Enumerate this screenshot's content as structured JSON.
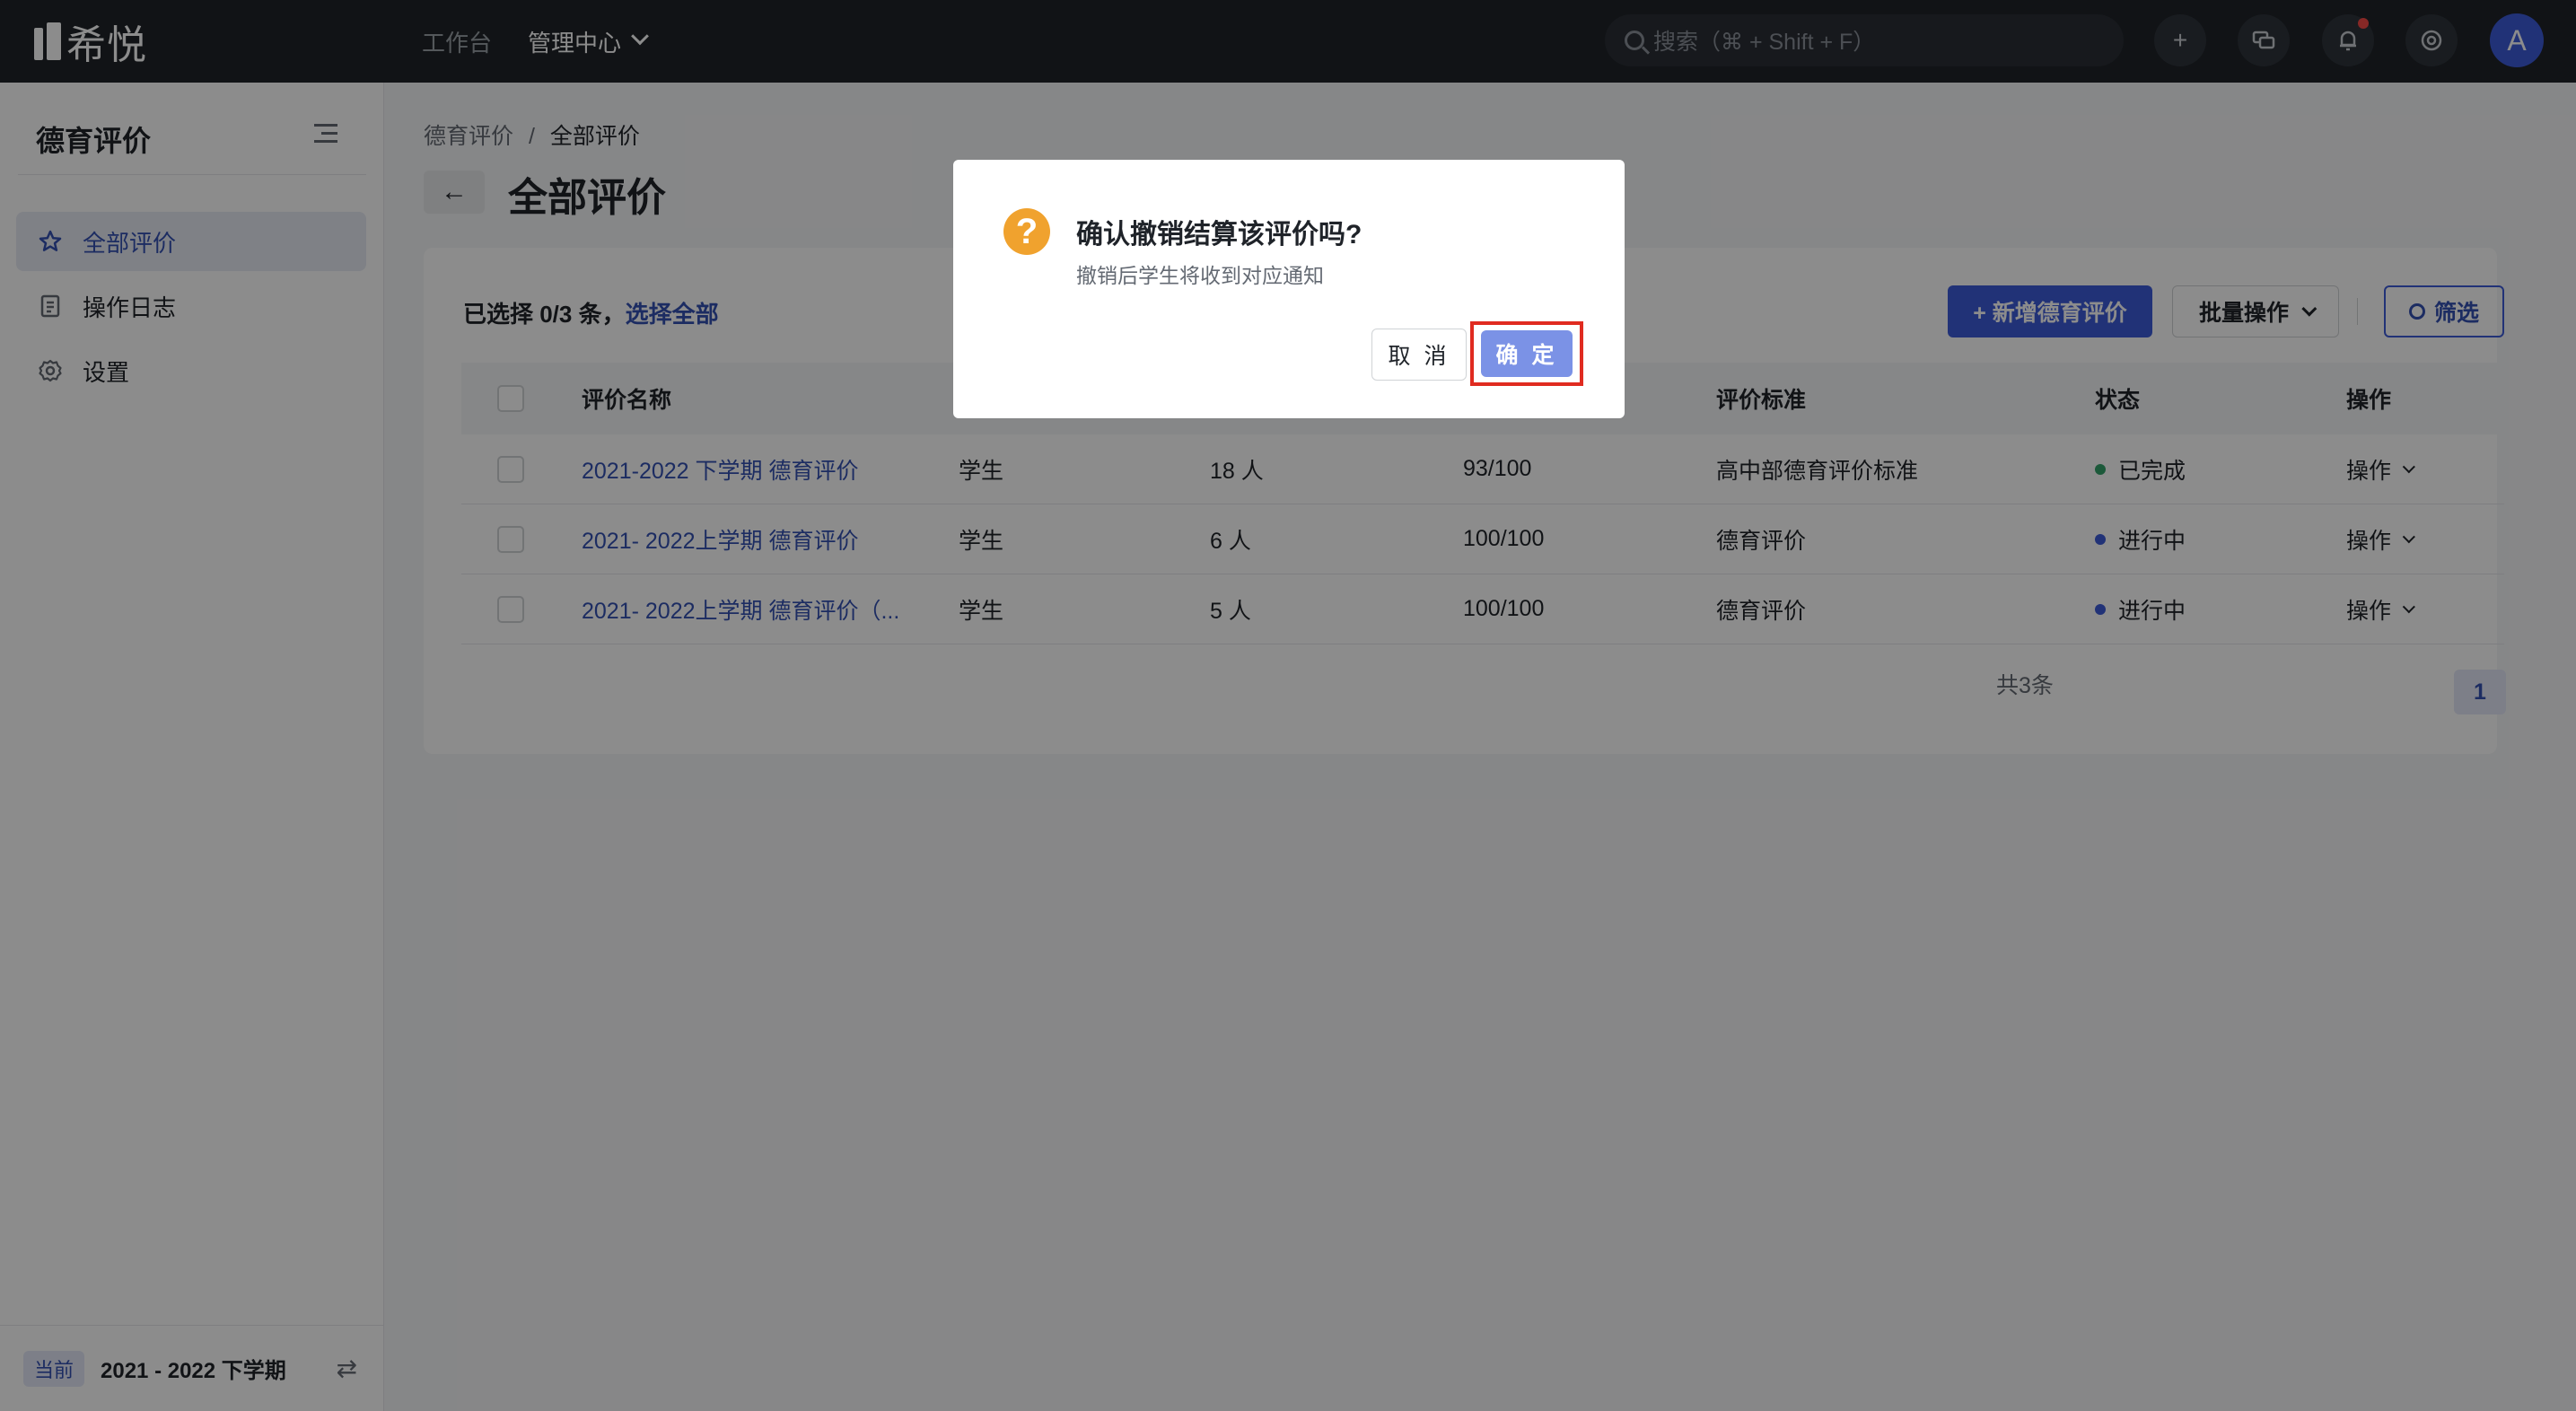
{
  "app": {
    "logo_text": "希悦",
    "nav": [
      {
        "label": "工作台"
      },
      {
        "label": "管理中心"
      }
    ],
    "search_placeholder": "搜索（⌘ + Shift + F）",
    "avatar_letter": "A"
  },
  "sidebar": {
    "title": "德育评价",
    "items": [
      {
        "label": "全部评价",
        "icon": "star-icon",
        "active": true
      },
      {
        "label": "操作日志",
        "icon": "log-icon",
        "active": false
      },
      {
        "label": "设置",
        "icon": "gear-icon",
        "active": false
      }
    ],
    "footer": {
      "tag": "当前",
      "term": "2021 - 2022 下学期"
    }
  },
  "breadcrumb": {
    "parent": "德育评价",
    "separator": "/",
    "current": "全部评价"
  },
  "page": {
    "title": "全部评价"
  },
  "toolbar": {
    "selection_prefix": "已选择 0/3 条，",
    "select_all": "选择全部",
    "add_button": "+ 新增德育评价",
    "batch_button": "批量操作",
    "filter_button": "筛选"
  },
  "table": {
    "headers": {
      "name": "评价名称",
      "standard": "评价标准",
      "status": "状态",
      "op": "操作"
    },
    "rows": [
      {
        "name": "2021-2022 下学期 德育评价",
        "type": "学生",
        "count": "18 人",
        "progress": "93/100",
        "standard": "高中部德育评价标准",
        "status": "已完成",
        "status_color": "#34a36b",
        "op": "操作"
      },
      {
        "name": "2021- 2022上学期 德育评价",
        "type": "学生",
        "count": "6 人",
        "progress": "100/100",
        "standard": "德育评价",
        "status": "进行中",
        "status_color": "#3d5bd9",
        "op": "操作"
      },
      {
        "name": "2021- 2022上学期 德育评价（...",
        "type": "学生",
        "count": "5 人",
        "progress": "100/100",
        "standard": "德育评价",
        "status": "进行中",
        "status_color": "#3d5bd9",
        "op": "操作"
      }
    ]
  },
  "pagination": {
    "total": "共3条",
    "current_page": "1"
  },
  "modal": {
    "title": "确认撤销结算该评价吗?",
    "description": "撤销后学生将收到对应通知",
    "cancel": "取 消",
    "confirm": "确 定"
  }
}
